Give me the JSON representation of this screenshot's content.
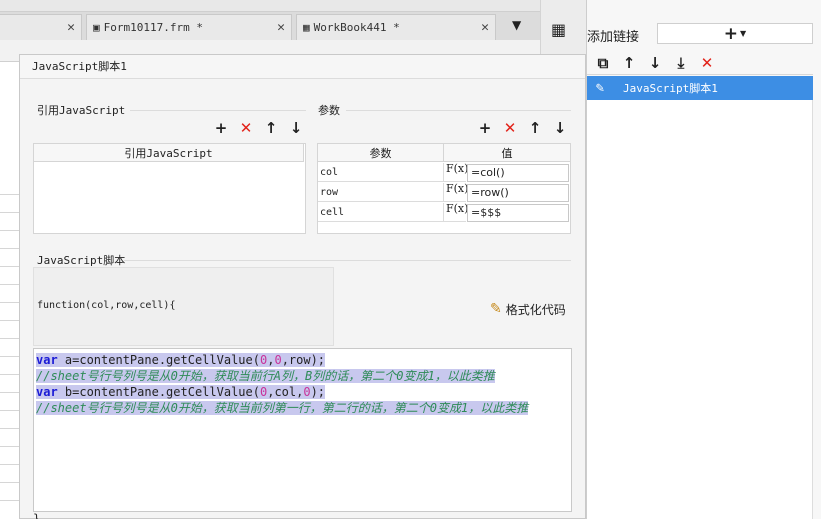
{
  "editor": {
    "tabs": [
      {
        "label": "Form10117.frm *"
      },
      {
        "label": "WorkBook441 *"
      }
    ]
  },
  "right_panel": {
    "add_link_label": "添加链接",
    "add_link_button": "+",
    "links": [
      {
        "label": "JavaScript脚本1"
      }
    ]
  },
  "dialog": {
    "title": "JavaScript脚本1",
    "ref_js": {
      "section_title": "引用JavaScript",
      "column_header": "引用JavaScript",
      "rows": []
    },
    "params": {
      "section_title": "参数",
      "col_param": "参数",
      "col_value": "值",
      "rows": [
        {
          "name": "col",
          "fx": "F(x)",
          "value": "=col()"
        },
        {
          "name": "row",
          "fx": "F(x)",
          "value": "=row()"
        },
        {
          "name": "cell",
          "fx": "F(x)",
          "value": "=$$$"
        }
      ]
    },
    "script": {
      "section_title": "JavaScript脚本",
      "signature": "function(col,row,cell){",
      "format_button": "格式化代码",
      "closing": "}",
      "lines": [
        {
          "kw": "var",
          "text": " a=contentPane.getCellValue(",
          "n1": "0",
          "sep1": ",",
          "n2": "0",
          "tail": ",row);"
        },
        {
          "comment": "//sheet号行号列号是从0开始，获取当前行A列，B列的话，第二个0变成1，以此类推"
        },
        {
          "kw": "var",
          "text": " b=contentPane.getCellValue(",
          "n1": "0",
          "sep1": ",col,",
          "n2": "0",
          "tail": ");"
        },
        {
          "comment": "//sheet号行号列号是从0开始，获取当前列第一行，第二行的话，第二个0变成1，以此类推"
        }
      ]
    }
  }
}
